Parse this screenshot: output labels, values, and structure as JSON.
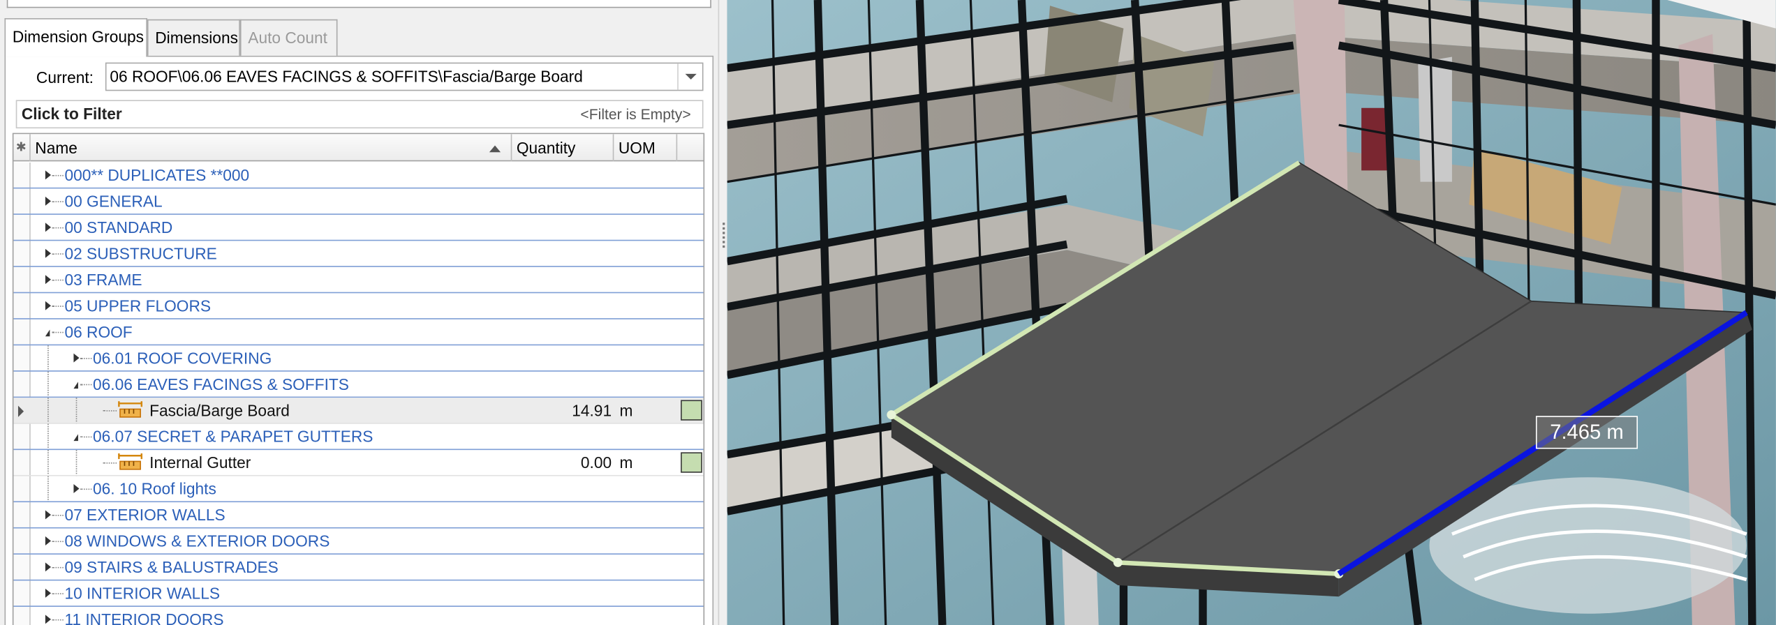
{
  "tabs": [
    {
      "label": "Dimension Groups",
      "active": true
    },
    {
      "label": "Dimensions",
      "active": false
    },
    {
      "label": "Auto Count",
      "active": false,
      "disabled": true
    }
  ],
  "current": {
    "label": "Current:",
    "value": "06 ROOF\\06.06 EAVES FACINGS & SOFFITS\\Fascia/Barge Board"
  },
  "filter": {
    "title": "Click to Filter",
    "status": "<Filter is Empty>"
  },
  "grid": {
    "columns": [
      "Name",
      "Quantity",
      "UOM"
    ],
    "new_row_symbol": "✱",
    "rows": [
      {
        "label": "000** DUPLICATES **000",
        "level": 0,
        "type": "group",
        "expanded": false
      },
      {
        "label": "00 GENERAL",
        "level": 0,
        "type": "group",
        "expanded": false
      },
      {
        "label": "00 STANDARD",
        "level": 0,
        "type": "group",
        "expanded": false
      },
      {
        "label": "02 SUBSTRUCTURE",
        "level": 0,
        "type": "group",
        "expanded": false
      },
      {
        "label": "03 FRAME",
        "level": 0,
        "type": "group",
        "expanded": false
      },
      {
        "label": "05 UPPER FLOORS",
        "level": 0,
        "type": "group",
        "expanded": false
      },
      {
        "label": "06 ROOF",
        "level": 0,
        "type": "group",
        "expanded": true
      },
      {
        "label": "06.01 ROOF COVERING",
        "level": 1,
        "type": "group",
        "expanded": false
      },
      {
        "label": "06.06 EAVES FACINGS & SOFFITS",
        "level": 1,
        "type": "group",
        "expanded": true
      },
      {
        "label": "Fascia/Barge Board",
        "level": 2,
        "type": "item",
        "quantity": "14.91",
        "uom": "m",
        "selected": true,
        "swatch": "#c5ddb0"
      },
      {
        "label": "06.07 SECRET & PARAPET GUTTERS",
        "level": 1,
        "type": "group",
        "expanded": true
      },
      {
        "label": "Internal Gutter",
        "level": 2,
        "type": "item",
        "quantity": "0.00",
        "uom": "m",
        "selected": false,
        "swatch": "#c5ddb0"
      },
      {
        "label": "06. 10 Roof lights",
        "level": 1,
        "type": "group",
        "expanded": false
      },
      {
        "label": "07 EXTERIOR WALLS",
        "level": 0,
        "type": "group",
        "expanded": false
      },
      {
        "label": "08 WINDOWS & EXTERIOR DOORS",
        "level": 0,
        "type": "group",
        "expanded": false
      },
      {
        "label": "09 STAIRS & BALUSTRADES",
        "level": 0,
        "type": "group",
        "expanded": false
      },
      {
        "label": "10 INTERIOR WALLS",
        "level": 0,
        "type": "group",
        "expanded": false
      },
      {
        "label": "11 INTERIOR DOORS",
        "level": 0,
        "type": "group",
        "expanded": false
      }
    ]
  },
  "viewport": {
    "measurement": "7.465 m",
    "colors": {
      "roof_slab": "#4a4a4a",
      "fascia_edge": "#d2e7b4",
      "measured_edge": "#0a14e0",
      "glazing": "#7fa8b4",
      "mullion": "#101418",
      "column": "#c9b3b3"
    }
  }
}
